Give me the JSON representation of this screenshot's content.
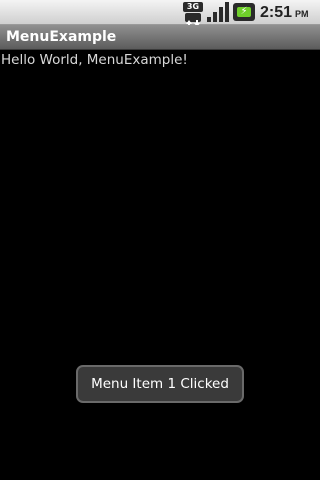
{
  "status_bar": {
    "network_label": "3G",
    "time": "2:51",
    "ampm": "PM",
    "icons": [
      "network-3g-icon",
      "signal-strength-icon",
      "battery-charging-icon"
    ]
  },
  "app": {
    "title": "MenuExample",
    "content_text": "Hello World, MenuExample!"
  },
  "toast": {
    "message": "Menu Item 1 Clicked"
  },
  "colors": {
    "background": "#000000",
    "title_bar": "#6e6e6e",
    "status_bar": "#dcdcdc",
    "toast_bg": "#3a3a3a",
    "battery_fill": "#6fcf2a"
  }
}
